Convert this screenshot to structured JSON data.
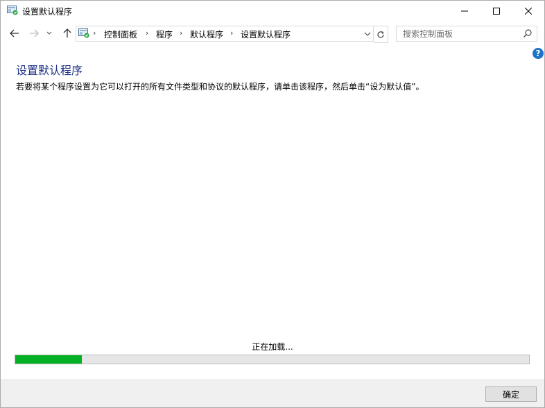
{
  "window": {
    "title": "设置默认程序"
  },
  "nav": {
    "breadcrumbs": [
      "控制面板",
      "程序",
      "默认程序",
      "设置默认程序"
    ]
  },
  "search": {
    "placeholder": "搜索控制面板"
  },
  "help": {
    "glyph": "?"
  },
  "main": {
    "title": "设置默认程序",
    "description": "若要将某个程序设置为它可以打开的所有文件类型和协议的默认程序，请单击该程序，然后单击“设为默认值”。",
    "loading_text": "正在加载...",
    "progress_fraction": 0.13
  },
  "footer": {
    "ok_label": "确定"
  },
  "colors": {
    "title": "#1e3287",
    "progress": "#06b025",
    "help": "#1e73c8"
  }
}
